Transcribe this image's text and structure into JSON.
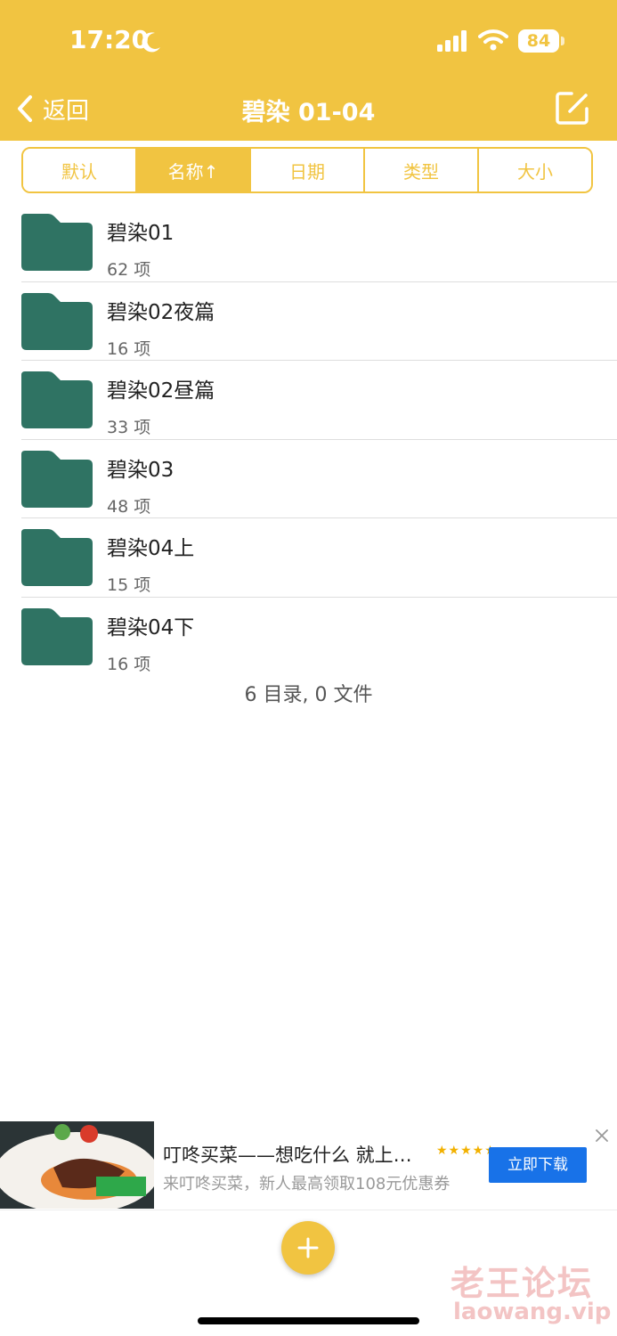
{
  "status_bar": {
    "time": "17:20",
    "battery": "84"
  },
  "nav": {
    "back_label": "返回",
    "title": "碧染 01-04"
  },
  "sort": {
    "segments": [
      "默认",
      "名称↑",
      "日期",
      "类型",
      "大小"
    ],
    "active_index": 1
  },
  "items": [
    {
      "name": "碧染01",
      "count": "62 项"
    },
    {
      "name": "碧染02夜篇",
      "count": "16 项"
    },
    {
      "name": "碧染02昼篇",
      "count": "33 项"
    },
    {
      "name": "碧染03",
      "count": "48 项"
    },
    {
      "name": "碧染04上",
      "count": "15 项"
    },
    {
      "name": "碧染04下",
      "count": "16 项"
    }
  ],
  "summary": "6 目录, 0 文件",
  "ad": {
    "title": "叮咚买菜——想吃什么 就上…",
    "description": "来叮咚买菜，新人最高领取108元优惠券",
    "button": "立即下载",
    "stars": "★★★★★"
  },
  "watermark": {
    "cn": "老王论坛",
    "en": "laowang.vip"
  },
  "colors": {
    "accent": "#f1c441",
    "folder": "#2f7363",
    "ad_button": "#1872e8"
  },
  "icons": [
    "moon-icon",
    "signal-icon",
    "wifi-icon",
    "chevron-left-icon",
    "edit-icon",
    "folder-icon",
    "close-icon",
    "plus-icon"
  ]
}
